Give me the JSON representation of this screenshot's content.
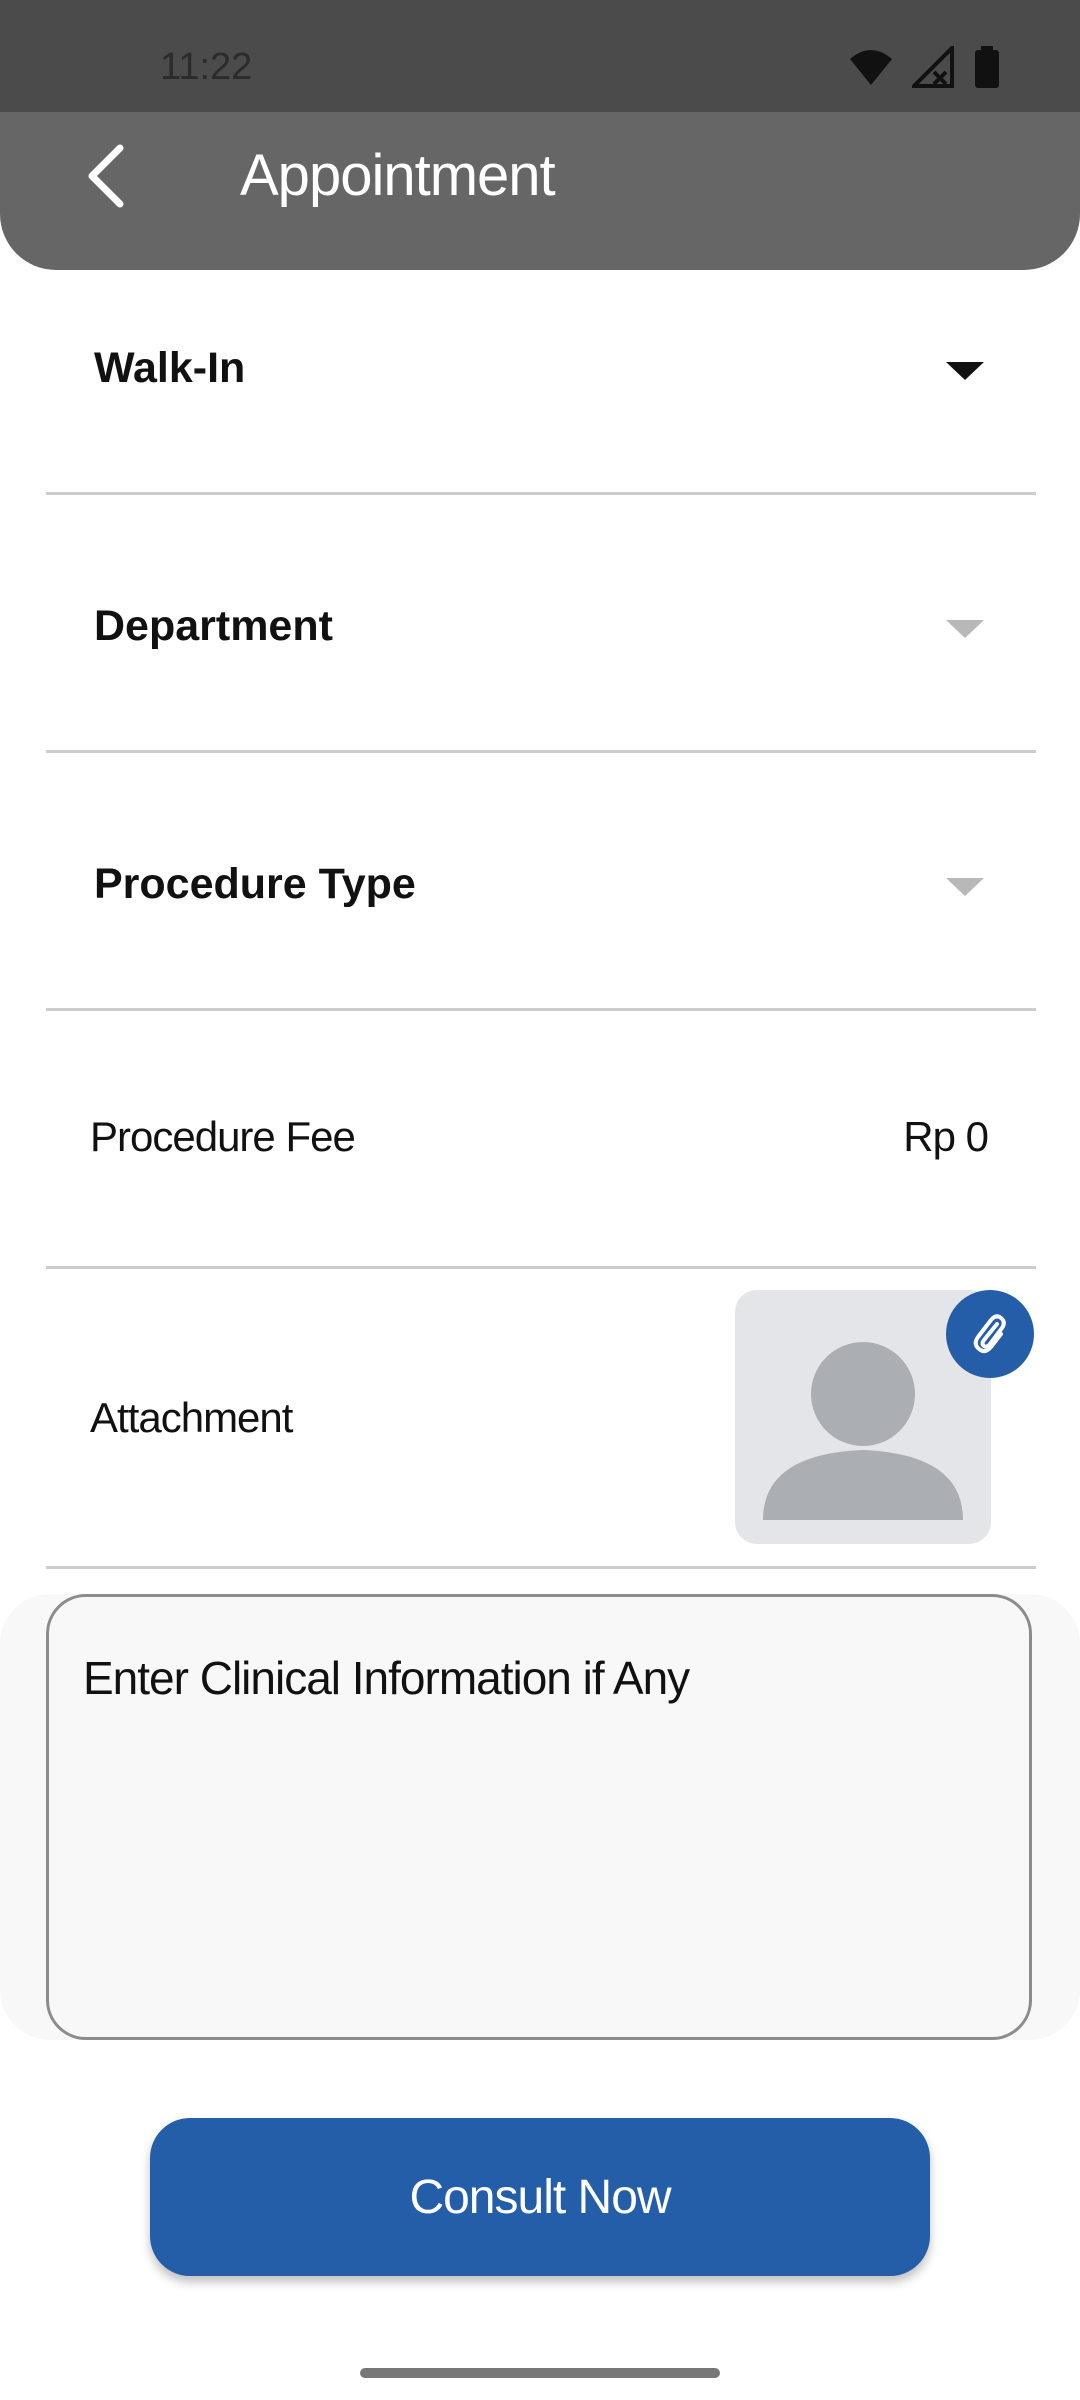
{
  "status_bar": {
    "time": "11:22",
    "icons": [
      "wifi-icon",
      "signal-off-icon",
      "battery-icon"
    ]
  },
  "app_bar": {
    "title": "Appointment",
    "back_icon": "chevron-left-icon"
  },
  "form": {
    "appointment_type": {
      "value": "Walk-In"
    },
    "department": {
      "placeholder": "Department"
    },
    "procedure_type": {
      "placeholder": "Procedure Type"
    },
    "procedure_fee": {
      "label": "Procedure Fee",
      "value": "Rp 0"
    },
    "attachment": {
      "label": "Attachment",
      "icon": "paperclip-icon",
      "placeholder_icon": "avatar-placeholder-icon"
    },
    "clinical_info": {
      "placeholder": "Enter Clinical Information if Any"
    }
  },
  "actions": {
    "consult_label": "Consult Now"
  },
  "colors": {
    "primary": "#245ea8",
    "appbar": "#666666",
    "statusbar": "#4b4b4b"
  }
}
